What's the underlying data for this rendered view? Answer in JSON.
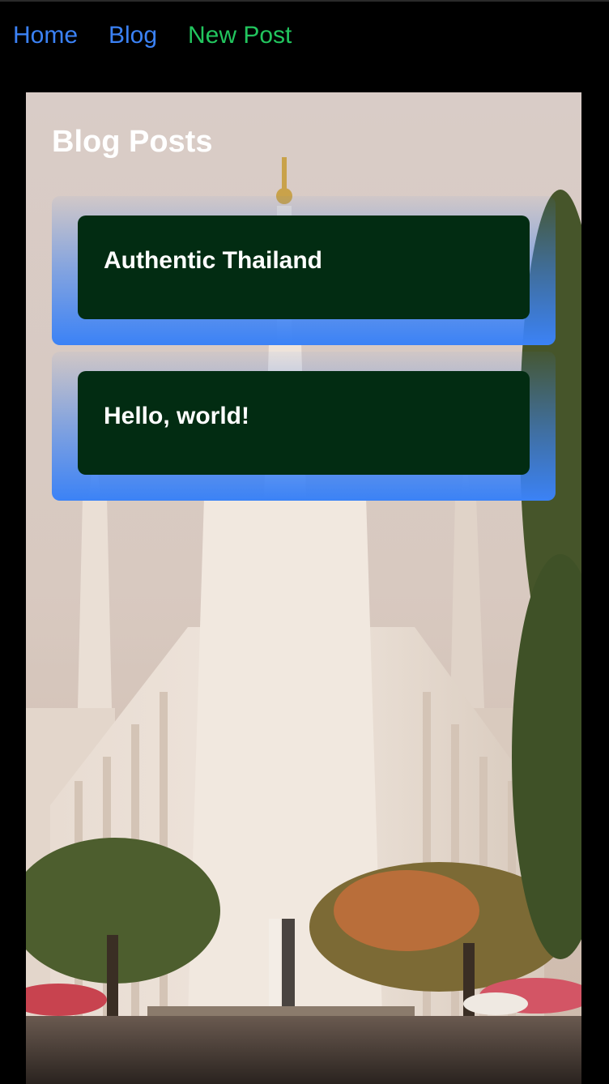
{
  "nav": {
    "home": "Home",
    "blog": "Blog",
    "new_post": "New Post"
  },
  "main": {
    "title": "Blog Posts",
    "posts": [
      {
        "title": "Authentic Thailand"
      },
      {
        "title": "Hello, world!"
      }
    ]
  },
  "colors": {
    "nav_link": "#3b82f6",
    "nav_active": "#22c55e",
    "card_bg": "#022c12",
    "card_frame": "#3b82f6"
  }
}
